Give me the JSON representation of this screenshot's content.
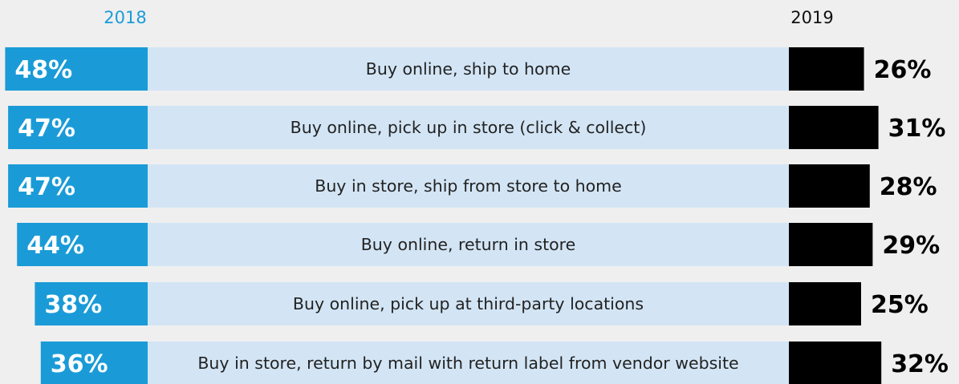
{
  "chart_data": {
    "type": "bar",
    "title": "",
    "xlabel": "",
    "ylabel": "",
    "categories": [
      "Buy online, ship to home",
      "Buy online, pick up in store (click & collect)",
      "Buy in store, ship from store to home",
      "Buy online, return in store",
      "Buy online, pick up at third-party locations",
      "Buy in store, return by mail with return label from vendor website"
    ],
    "series": [
      {
        "name": "2018",
        "values": [
          48,
          47,
          47,
          44,
          38,
          36
        ],
        "labels": [
          "48%",
          "47%",
          "47%",
          "44%",
          "38%",
          "36%"
        ],
        "color": "#1a9bd7"
      },
      {
        "name": "2019",
        "values": [
          26,
          31,
          28,
          29,
          25,
          32
        ],
        "labels": [
          "26%",
          "31%",
          "28%",
          "29%",
          "25%",
          "32%"
        ],
        "color": "#000000"
      }
    ],
    "category_band_color": "#d3e5f5",
    "background_color": "#efefef",
    "legend": "top",
    "grid": false
  }
}
